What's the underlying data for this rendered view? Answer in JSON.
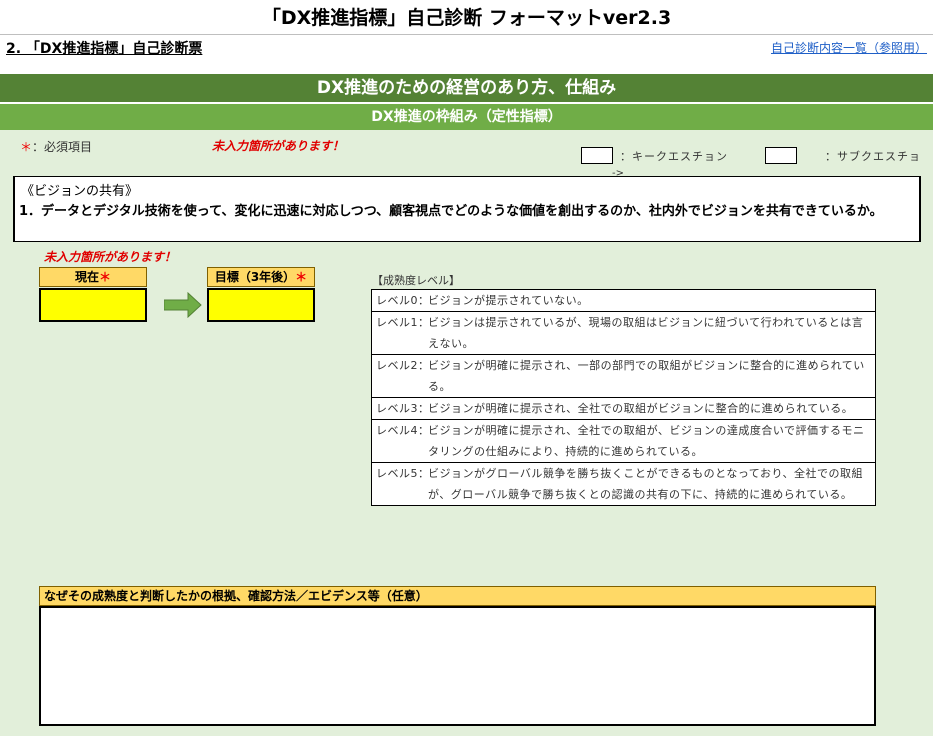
{
  "page": {
    "title": "「DX推進指標」自己診断 フォーマットver2.3",
    "sheet_title": "2. 「DX推進指標」自己診断票",
    "reference_link": "自己診断内容一覧（参照用）"
  },
  "bands": {
    "main": "DX推進のための経営のあり方、仕組み",
    "sub": "DX推進の枠組み（定性指標）"
  },
  "notes": {
    "required_star": "＊",
    "required_label": "：必須項目",
    "warning": "未入力箇所があります！"
  },
  "legend": {
    "key_question": "：キークエスチョン",
    "sub_question": "：サブクエスチョ",
    "arrow_mark": "->"
  },
  "question": {
    "heading": "《ビジョンの共有》",
    "text": "1．データとデジタル技術を使って、変化に迅速に対応しつつ、顧客視点でどのような価値を創出するのか、社内外でビジョンを共有できているか。"
  },
  "maturity_input": {
    "warning": "未入力箇所があります！",
    "current_label": "現在",
    "target_label": "目標（3年後）",
    "star": "＊",
    "current_value": "",
    "target_value": ""
  },
  "levels": {
    "title": "【成熟度レベル】",
    "items": [
      {
        "name": "レベル0：",
        "text": "ビジョンが提示されていない。"
      },
      {
        "name": "レベル1：",
        "text": "ビジョンは提示されているが、現場の取組はビジョンに紐づいて行われているとは言えない。"
      },
      {
        "name": "レベル2：",
        "text": "ビジョンが明確に提示され、一部の部門での取組がビジョンに整合的に進められている。"
      },
      {
        "name": "レベル3：",
        "text": "ビジョンが明確に提示され、全社での取組がビジョンに整合的に進められている。"
      },
      {
        "name": "レベル4：",
        "text": "ビジョンが明確に提示され、全社での取組が、ビジョンの達成度合いで評価するモニタリングの仕組みにより、持続的に進められている。"
      },
      {
        "name": "レベル5：",
        "text": "ビジョンがグローバル競争を勝ち抜くことができるものとなっており、全社での取組が、グローバル競争で勝ち抜くとの認識の共有の下に、持続的に進められている。"
      }
    ]
  },
  "evidence": {
    "label": "なぜその成熟度と判断したかの根拠、確認方法／エビデンス等（任意）",
    "value": ""
  },
  "colors": {
    "band_dark": "#548235",
    "band_light": "#70ad47",
    "background": "#e2efda",
    "header_cell": "#ffd966",
    "input_cell": "#ffff00",
    "warning": "#e00000",
    "link": "#1f5fc7"
  }
}
